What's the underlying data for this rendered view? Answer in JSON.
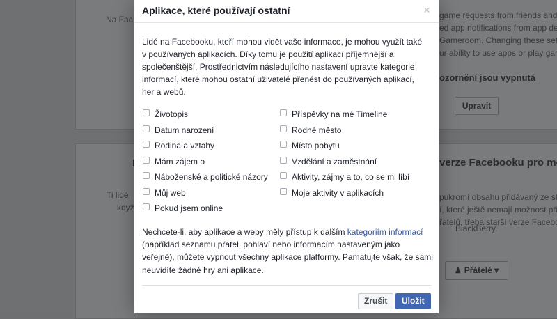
{
  "background": {
    "top_left_text": "Na Fac",
    "top_right_lines": [
      "game requests from friends and",
      "ed app notifications from app deve",
      "Gameroom. Changing these settin",
      "ur ability to use apps or play game"
    ],
    "notifications_off": "ozornění jsou vypnutá",
    "edit_button": "Upravit",
    "mid_left_heading": "I",
    "mid_left_lines": [
      "Ti lidé,",
      "když"
    ],
    "mid_right_title": "verze Facebooku pro mobi",
    "mid_right_lines": [
      "pukromí obsahu přidávaný ze sta",
      "í, které ještě nemají možnost při",
      "řatelů, třeba starší verze Faceboo",
      "BlackBerry."
    ],
    "friends_button": "Přátelé",
    "friends_icon": "people-icon"
  },
  "modal": {
    "title": "Aplikace, které používají ostatní",
    "close_label": "×",
    "intro": "Lidé na Facebooku, kteří mohou vidět vaše informace, je mohou využít také v používaných aplikacích. Díky tomu je použití aplikací příjemnější a společenštější. Prostřednictvím následujícího nastavení upravte kategorie informací, které mohou ostatní uživatelé přenést do používaných aplikací, her a webů.",
    "left_options": [
      "Životopis",
      "Datum narození",
      "Rodina a vztahy",
      "Mám zájem o",
      "Náboženské a politické názory",
      "Můj web",
      "Pokud jsem online"
    ],
    "right_options": [
      "Příspěvky na mé Timeline",
      "Rodné město",
      "Místo pobytu",
      "Vzdělání a zaměstnání",
      "Aktivity, zájmy a to, co se mi líbí",
      "Moje aktivity v aplikacích"
    ],
    "note_before_link": "Nechcete-li, aby aplikace a weby měly přístup k dalším ",
    "note_link": "kategoriím informací",
    "note_after_link": " (například seznamu přátel, pohlaví nebo informacím nastaveným jako veřejné), můžete vypnout všechny aplikace platformy. Pamatujte však, že sami neuvidíte žádné hry ani aplikace.",
    "cancel_label": "Zrušit",
    "save_label": "Uložit",
    "colors": {
      "primary": "#4267b2",
      "link": "#365899"
    }
  }
}
